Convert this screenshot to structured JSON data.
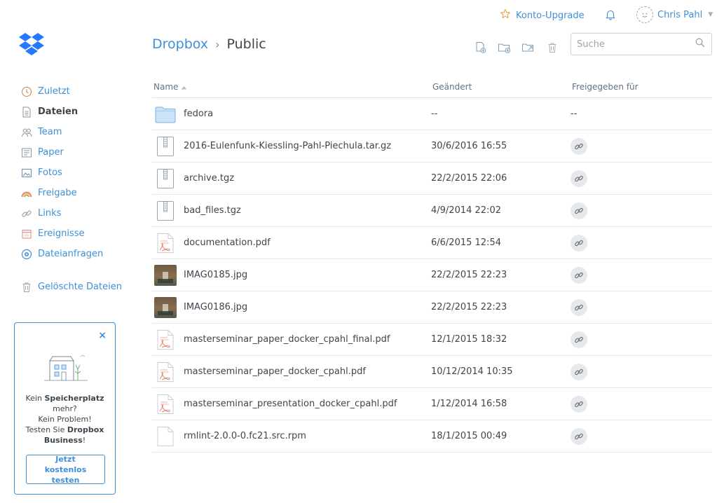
{
  "top": {
    "upgrade_label": "Konto-Upgrade",
    "user_name": "Chris Pahl"
  },
  "breadcrumb": {
    "root": "Dropbox",
    "separator": "›",
    "current": "Public"
  },
  "search": {
    "placeholder": "Suche"
  },
  "sidebar": {
    "items": [
      {
        "label": "Zuletzt",
        "icon": "clock-icon"
      },
      {
        "label": "Dateien",
        "icon": "file-icon"
      },
      {
        "label": "Team",
        "icon": "team-icon"
      },
      {
        "label": "Paper",
        "icon": "paper-icon"
      },
      {
        "label": "Fotos",
        "icon": "photo-icon"
      },
      {
        "label": "Freigabe",
        "icon": "rainbow-icon"
      },
      {
        "label": "Links",
        "icon": "link-icon"
      },
      {
        "label": "Ereignisse",
        "icon": "calendar-icon"
      },
      {
        "label": "Dateianfragen",
        "icon": "file-request-icon"
      }
    ],
    "deleted": "Gelöschte Dateien"
  },
  "promo": {
    "line1_a": "Kein ",
    "line1_b": "Speicherplatz",
    "line2": "mehr?",
    "line3": "Kein Problem!",
    "line4_a": "Testen Sie ",
    "line4_b": "Dropbox",
    "line5_b": "Business",
    "line5_c": "!",
    "button": "Jetzt kostenlos testen",
    "close": "×"
  },
  "table": {
    "col_name": "Name",
    "col_modified": "Geändert",
    "col_shared": "Freigegeben für",
    "rows": [
      {
        "name": "fedora",
        "modified": "--",
        "shared": "--",
        "type": "folder"
      },
      {
        "name": "2016-Eulenfunk-Kiessling-Pahl-Piechula.tar.gz",
        "modified": "30/6/2016 16:55",
        "type": "archive"
      },
      {
        "name": "archive.tgz",
        "modified": "22/2/2015 22:06",
        "type": "archive"
      },
      {
        "name": "bad_files.tgz",
        "modified": "4/9/2014 22:02",
        "type": "archive"
      },
      {
        "name": "documentation.pdf",
        "modified": "6/6/2015 12:54",
        "type": "pdf"
      },
      {
        "name": "IMAG0185.jpg",
        "modified": "22/2/2015 22:23",
        "type": "image"
      },
      {
        "name": "IMAG0186.jpg",
        "modified": "22/2/2015 22:23",
        "type": "image"
      },
      {
        "name": "masterseminar_paper_docker_cpahl_final.pdf",
        "modified": "12/1/2015 18:32",
        "type": "pdf"
      },
      {
        "name": "masterseminar_paper_docker_cpahl.pdf",
        "modified": "10/12/2014 10:35",
        "type": "pdf"
      },
      {
        "name": "masterseminar_presentation_docker_cpahl.pdf",
        "modified": "1/12/2014 16:58",
        "type": "pdf"
      },
      {
        "name": "rmlint-2.0.0-0.fc21.src.rpm",
        "modified": "18/1/2015 00:49",
        "type": "file"
      }
    ]
  },
  "colors": {
    "accent": "#3d8fd8",
    "text": "#3d464d"
  }
}
